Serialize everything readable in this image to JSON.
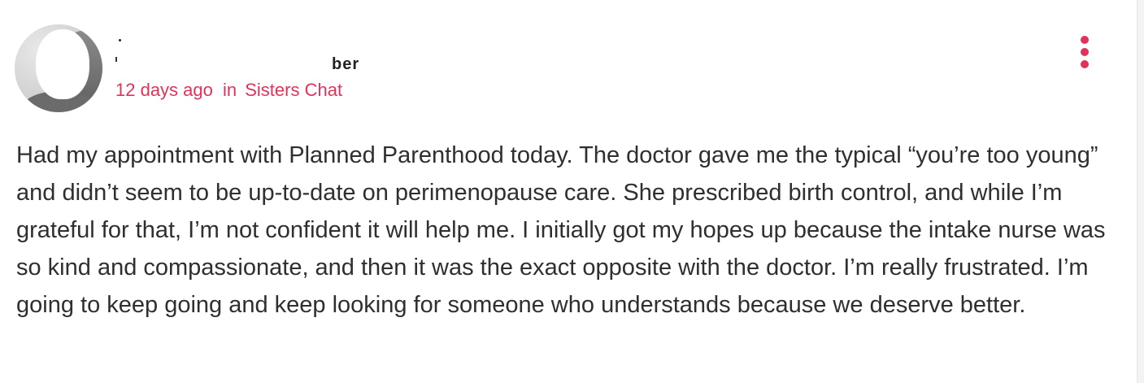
{
  "post": {
    "author_name_visible": "ber",
    "time_ago": "12 days ago",
    "in_label": "in",
    "group_name": "Sisters Chat",
    "body": "Had my appointment with Planned Parenthood today. The doctor gave me the typical “you’re too young” and didn’t seem to be up-to-date on perimenopause care. She prescribed birth control, and while I’m grateful for that, I’m not confident it will help me. I initially got my hopes up because the intake nurse was so kind and compassionate, and then it was the exact opposite with the doctor. I’m really frustrated. I’m going to keep going and keep looking for someone who understands because we deserve better."
  },
  "icons": {
    "more": "vertical-ellipsis-icon"
  },
  "colors": {
    "accent": "#e0335c",
    "text": "#2f2f2f",
    "background": "#ffffff"
  }
}
